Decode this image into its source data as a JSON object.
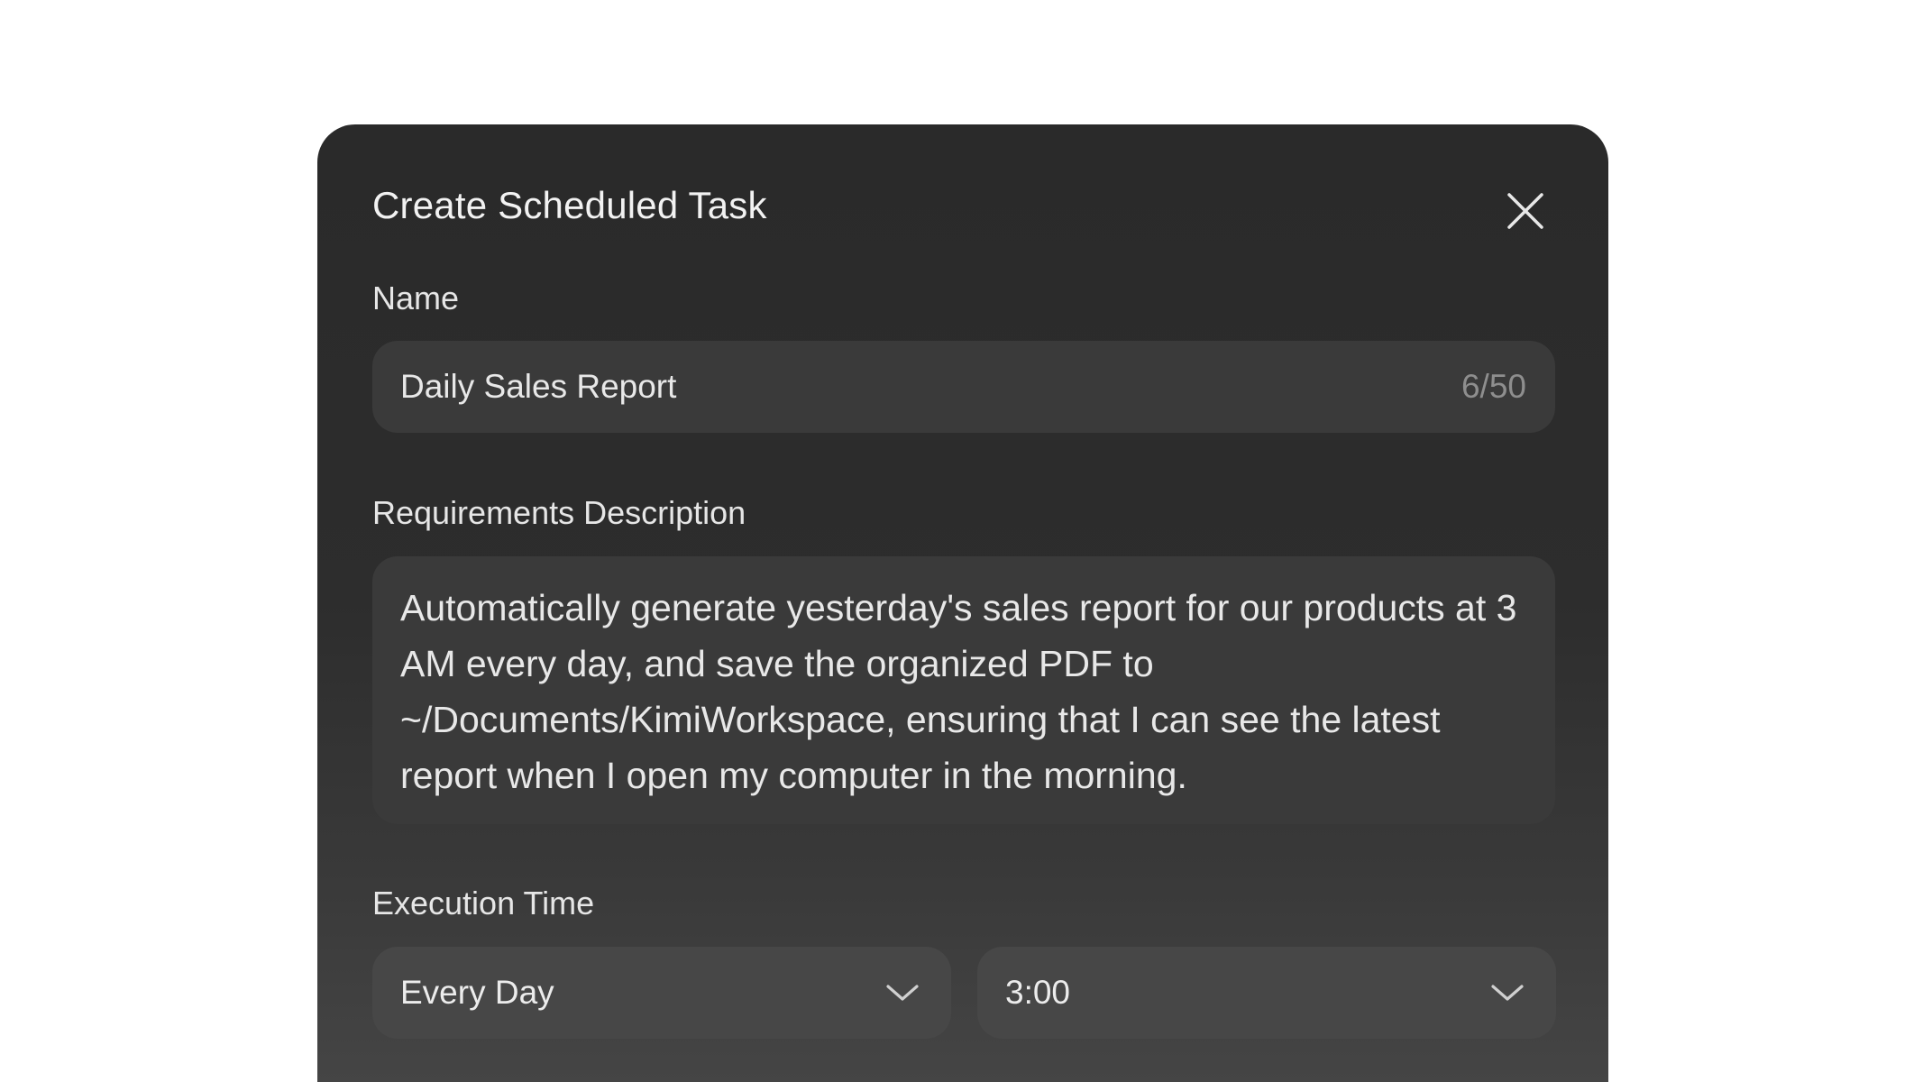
{
  "dialog": {
    "title": "Create Scheduled Task",
    "close_icon": "close-icon"
  },
  "name_field": {
    "label": "Name",
    "value": "Daily Sales Report",
    "counter": "6/50"
  },
  "description_field": {
    "label": "Requirements Description",
    "value": "Automatically generate yesterday's sales report for our products at 3 AM every day, and save the organized PDF to ~/Documents/KimiWorkspace, ensuring that I can see the latest report when I open my computer in the morning."
  },
  "execution_time": {
    "label": "Execution Time",
    "frequency": "Every Day",
    "time": "3:00",
    "dropdown_icon": "chevron-down-icon"
  },
  "colors": {
    "dialog_background": "#2a2a2a",
    "field_background": "#3a3a3a",
    "text_primary": "#e8e8e8",
    "text_muted": "#8e8e8e"
  }
}
